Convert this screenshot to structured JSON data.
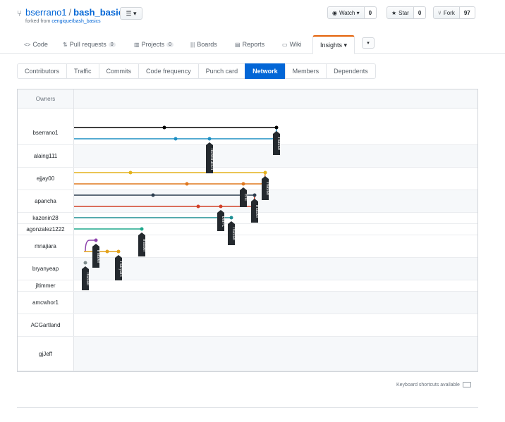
{
  "header": {
    "owner": "bserrano1",
    "separator": "/",
    "repo": "bash_basics",
    "forked_prefix": "forked from ",
    "forked_link": "cengique/bash_basics",
    "fork_icon": "repo-forked-icon",
    "list_icon": "list-icon",
    "watch": {
      "label": "Watch ▾",
      "count": "0",
      "icon": "eye-icon"
    },
    "star": {
      "label": "Star",
      "count": "0",
      "icon": "star-icon"
    },
    "fork": {
      "label": "Fork",
      "count": "97",
      "icon": "fork-icon"
    }
  },
  "nav": {
    "tabs": [
      {
        "label": "Code",
        "icon": "code-icon"
      },
      {
        "label": "Pull requests",
        "icon": "pull-request-icon",
        "count": "0"
      },
      {
        "label": "Projects",
        "icon": "project-icon",
        "count": "0"
      },
      {
        "label": "Boards",
        "icon": "boards-icon"
      },
      {
        "label": "Reports",
        "icon": "graph-icon"
      },
      {
        "label": "Wiki",
        "icon": "book-icon"
      },
      {
        "label": "Insights ▾",
        "selected": true
      }
    ],
    "more": "▾"
  },
  "subnav": [
    "Contributors",
    "Traffic",
    "Commits",
    "Code frequency",
    "Punch card",
    "Network",
    "Members",
    "Dependents"
  ],
  "subnav_active": "Network",
  "network": {
    "owners_header": "Owners",
    "owners": [
      "bserrano1",
      "alaing111",
      "ejjay00",
      "apancha",
      "kazenin28",
      "agonzalez1222",
      "mnajiara",
      "bryanyeap",
      "jltimmer",
      "amcwhor1",
      "ACGartland",
      "gjJeff"
    ],
    "branch_labels": [
      "newBranch",
      "master",
      "master",
      "Eric",
      "master",
      "ben-1",
      "master",
      "master",
      "master",
      "maryam",
      "master"
    ],
    "colors": {
      "black": "#000000",
      "blue": "#1d8fc4",
      "yellow": "#e3b21c",
      "orange": "#e0781f",
      "navy": "#2c3e50",
      "red": "#d14028",
      "teal": "#1e8f94",
      "green": "#1fa88c",
      "purple": "#8e44ad",
      "gold": "#e3a21c",
      "gray": "#7f8c8d"
    }
  },
  "footer": {
    "shortcuts": "Keyboard shortcuts available",
    "keyboard_icon": "keyboard-icon"
  }
}
